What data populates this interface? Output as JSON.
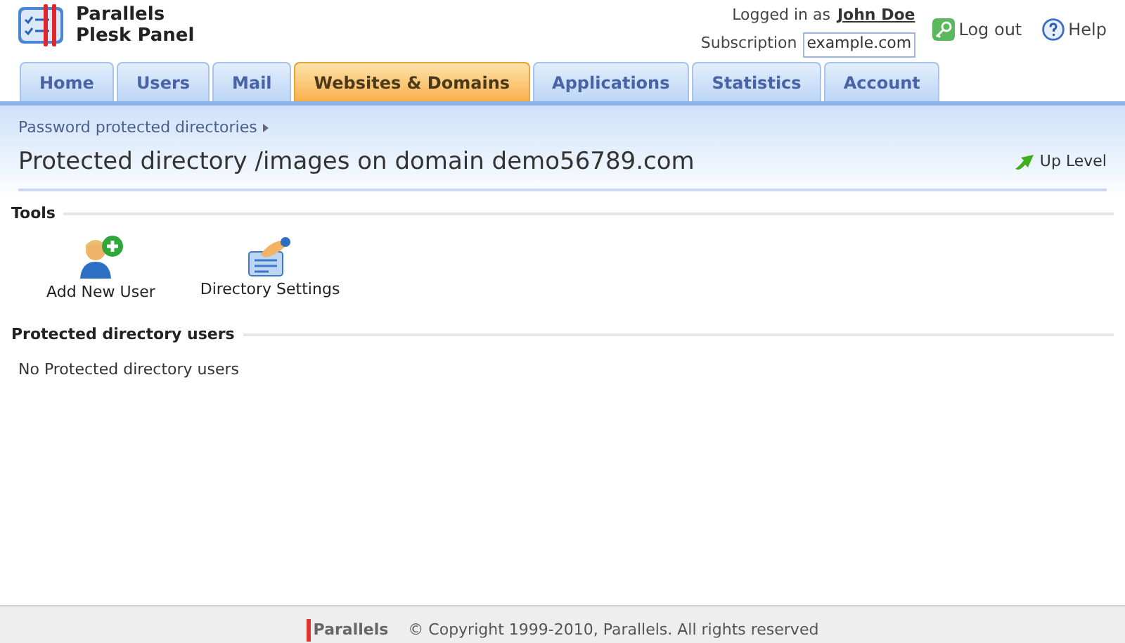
{
  "brand": {
    "line1": "Parallels",
    "line2": "Plesk Panel"
  },
  "user": {
    "logged_label": "Logged in as",
    "name": "John Doe",
    "subscription_label": "Subscription",
    "subscription": "example.com"
  },
  "header_links": [
    {
      "kind": "logout",
      "label": "Log out"
    },
    {
      "kind": "help",
      "label": "Help"
    }
  ],
  "tabs": [
    {
      "label": "Home",
      "selected": false
    },
    {
      "label": "Users",
      "selected": false
    },
    {
      "label": "Mail",
      "selected": false
    },
    {
      "label": "Websites & Domains",
      "selected": true
    },
    {
      "label": "Applications",
      "selected": false
    },
    {
      "label": "Statistics",
      "selected": false
    },
    {
      "label": "Account",
      "selected": false
    }
  ],
  "breadcrumb": "Password protected directories",
  "page_title": "Protected directory /images on domain demo56789.com",
  "up_level": "Up Level",
  "tools": {
    "title": "Tools",
    "items": [
      {
        "kind": "add-user",
        "label": "Add New User"
      },
      {
        "kind": "settings",
        "label": "Directory Settings"
      }
    ]
  },
  "users_section": {
    "title": "Protected directory users",
    "empty": "No Protected directory users"
  },
  "footer": {
    "logo": "Parallels",
    "copyright": "© Copyright 1999-2010, Parallels. All rights reserved"
  }
}
